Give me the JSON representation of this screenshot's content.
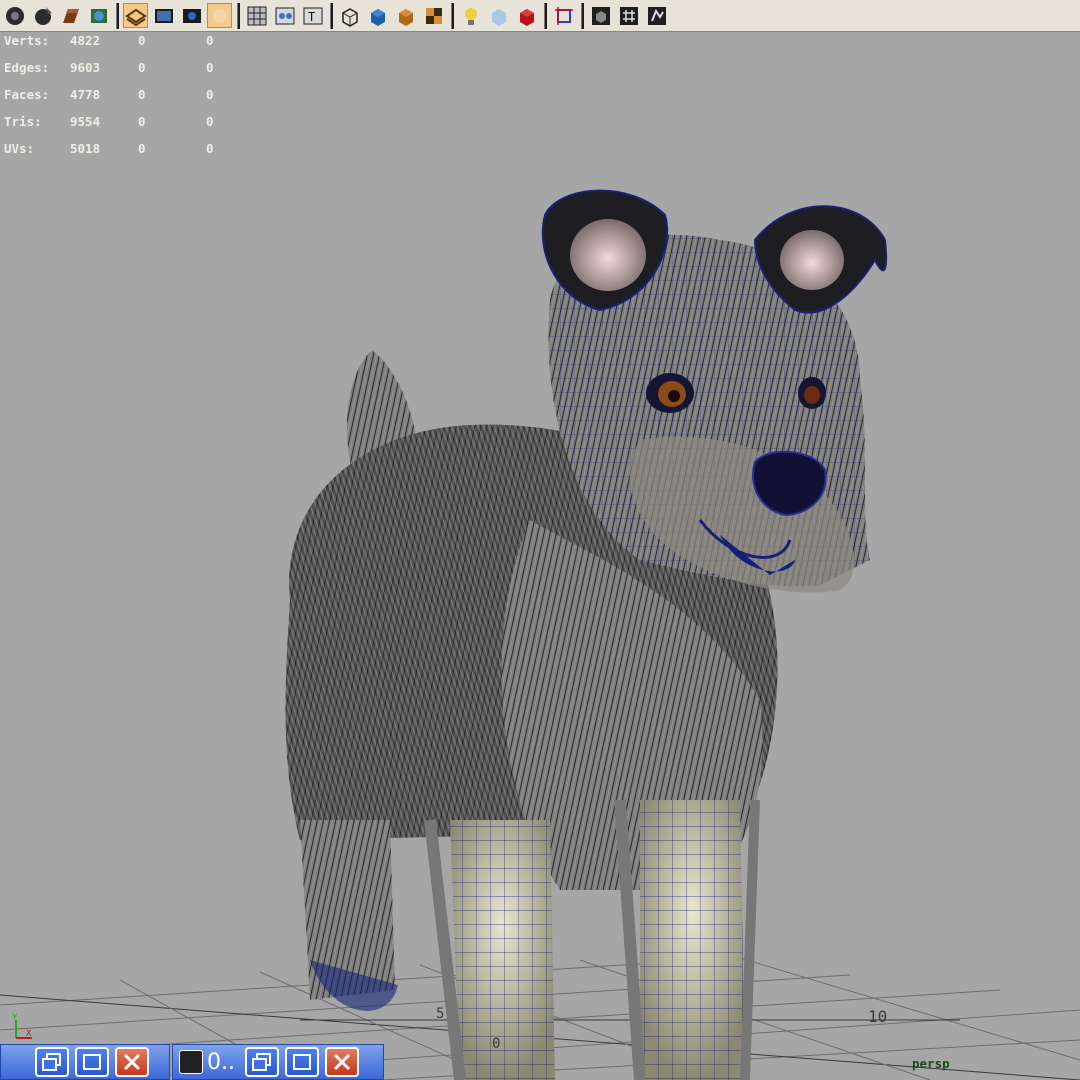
{
  "toolbar": {
    "icons": [
      "render-view-icon",
      "ipr-render-icon",
      "render-settings-icon",
      "hypershade-icon",
      "isolate-select-icon",
      "grid-toggle-icon",
      "film-gate-icon",
      "resolution-gate-icon",
      "safe-action-icon",
      "wireframe-icon",
      "smooth-shade-icon",
      "textured-icon",
      "use-all-lights-icon",
      "xray-icon",
      "shadows-icon",
      "default-light-icon",
      "high-quality-icon",
      "camera-attributes-icon",
      "bookmark-icon",
      "image-plane-icon"
    ]
  },
  "hud": {
    "rows": [
      {
        "label": "Verts:",
        "value": "4822",
        "selected": "0",
        "component": "0"
      },
      {
        "label": "Edges:",
        "value": "9603",
        "selected": "0",
        "component": "0"
      },
      {
        "label": "Faces:",
        "value": "4778",
        "selected": "0",
        "component": "0"
      },
      {
        "label": "Tris:",
        "value": "9554",
        "selected": "0",
        "component": "0"
      },
      {
        "label": "UVs:",
        "value": "5018",
        "selected": "0",
        "component": "0"
      }
    ]
  },
  "viewport": {
    "camera_label": "persp",
    "grid_labels": [
      "5",
      "10",
      "0"
    ],
    "background_color": "#a6a6a6",
    "wire_color": "#1a1f7a",
    "fur_color": "#7d7d7d"
  },
  "axis": {
    "y": "Y",
    "x": "X"
  },
  "taskbar": {
    "left_title": "",
    "right_title": "0..",
    "icons": [
      "restore-icon",
      "maximize-icon",
      "close-icon"
    ]
  }
}
